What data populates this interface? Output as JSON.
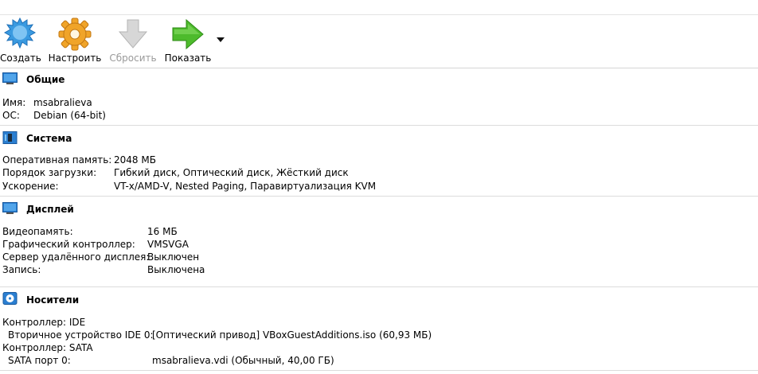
{
  "toolbar": {
    "create_label": "Создать",
    "settings_label": "Настроить",
    "discard_label": "Сбросить",
    "show_label": "Показать"
  },
  "general": {
    "title": "Общие",
    "rows": [
      {
        "label": "Имя:",
        "value": "msabralieva"
      },
      {
        "label": "ОС:",
        "value": "Debian (64-bit)"
      }
    ]
  },
  "system": {
    "title": "Система",
    "rows": [
      {
        "label": "Оперативная память:",
        "value": "2048 МБ"
      },
      {
        "label": "Порядок загрузки:",
        "value": "Гибкий диск, Оптический диск, Жёсткий диск"
      },
      {
        "label": "Ускорение:",
        "value": "VT-x/AMD-V, Nested Paging, Паравиртуализация KVM"
      }
    ]
  },
  "display": {
    "title": "Дисплей",
    "rows": [
      {
        "label": "Видеопамять:",
        "value": "16 МБ"
      },
      {
        "label": "Графический контроллер:",
        "value": "VMSVGA"
      },
      {
        "label": "Сервер удалённого дисплея:",
        "value": "Выключен"
      },
      {
        "label": "Запись:",
        "value": "Выключена"
      }
    ]
  },
  "storage": {
    "title": "Носители",
    "rows": [
      {
        "label": "Контроллер: IDE",
        "value": ""
      },
      {
        "label": " Вторичное устройство IDE 0:",
        "value": "[Оптический привод] VBoxGuestAdditions.iso (60,93 МБ)"
      },
      {
        "label": "Контроллер: SATA",
        "value": ""
      },
      {
        "label": " SATA порт 0:",
        "value": "msabralieva.vdi (Обычный, 40,00 ГБ)"
      }
    ]
  },
  "icons": {
    "create": "new-vm-icon",
    "settings": "gear-icon",
    "discard": "down-arrow-icon",
    "show": "right-arrow-icon"
  }
}
